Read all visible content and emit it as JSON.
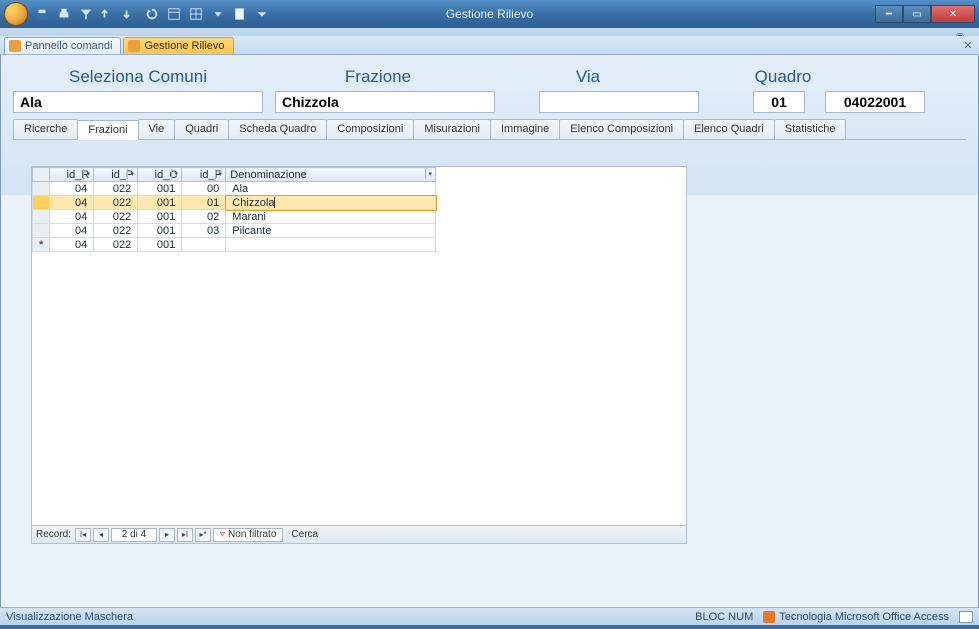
{
  "title": "Gestione Rilievo",
  "doc_tabs": {
    "pannello": "Pannello comandi",
    "gestione": "Gestione Rilievo"
  },
  "header": {
    "labels": {
      "comuni": "Seleziona Comuni",
      "frazione": "Frazione",
      "via": "Via",
      "quadro": "Quadro"
    },
    "values": {
      "comuni": "Ala",
      "frazione": "Chizzola",
      "via": "",
      "q1": "01",
      "q2": "04022001"
    }
  },
  "inner_tabs": {
    "ricerche": "Ricerche",
    "frazioni": "Frazioni",
    "vie": "Vie",
    "quadri": "Quadri",
    "scheda": "Scheda Quadro",
    "composizioni": "Composizioni",
    "misurazioni": "Misurazioni",
    "immagine": "Immagine",
    "elenco_comp": "Elenco Composizioni",
    "elenco_q": "Elenco Quadri",
    "stats": "Statistiche"
  },
  "grid": {
    "headers": {
      "id_r": "id_R",
      "id_p": "id_P",
      "id_c": "id_C",
      "id_f": "id_F",
      "den": "Denominazione"
    },
    "rows": [
      {
        "id_r": "04",
        "id_p": "022",
        "id_c": "001",
        "id_f": "00",
        "den": "Ala"
      },
      {
        "id_r": "04",
        "id_p": "022",
        "id_c": "001",
        "id_f": "01",
        "den": "Chizzola"
      },
      {
        "id_r": "04",
        "id_p": "022",
        "id_c": "001",
        "id_f": "02",
        "den": "Marani"
      },
      {
        "id_r": "04",
        "id_p": "022",
        "id_c": "001",
        "id_f": "03",
        "den": "Pilcante"
      }
    ],
    "new_row": {
      "id_r": "04",
      "id_p": "022",
      "id_c": "001",
      "id_f": "",
      "den": ""
    }
  },
  "recnav": {
    "label": "Record:",
    "pos": "2 di 4",
    "filter_label": "Non filtrato",
    "search": "Cerca"
  },
  "status": {
    "left": "Visualizzazione Maschera",
    "bloc": "BLOC NUM",
    "tech": "Tecnologia Microsoft Office Access"
  }
}
